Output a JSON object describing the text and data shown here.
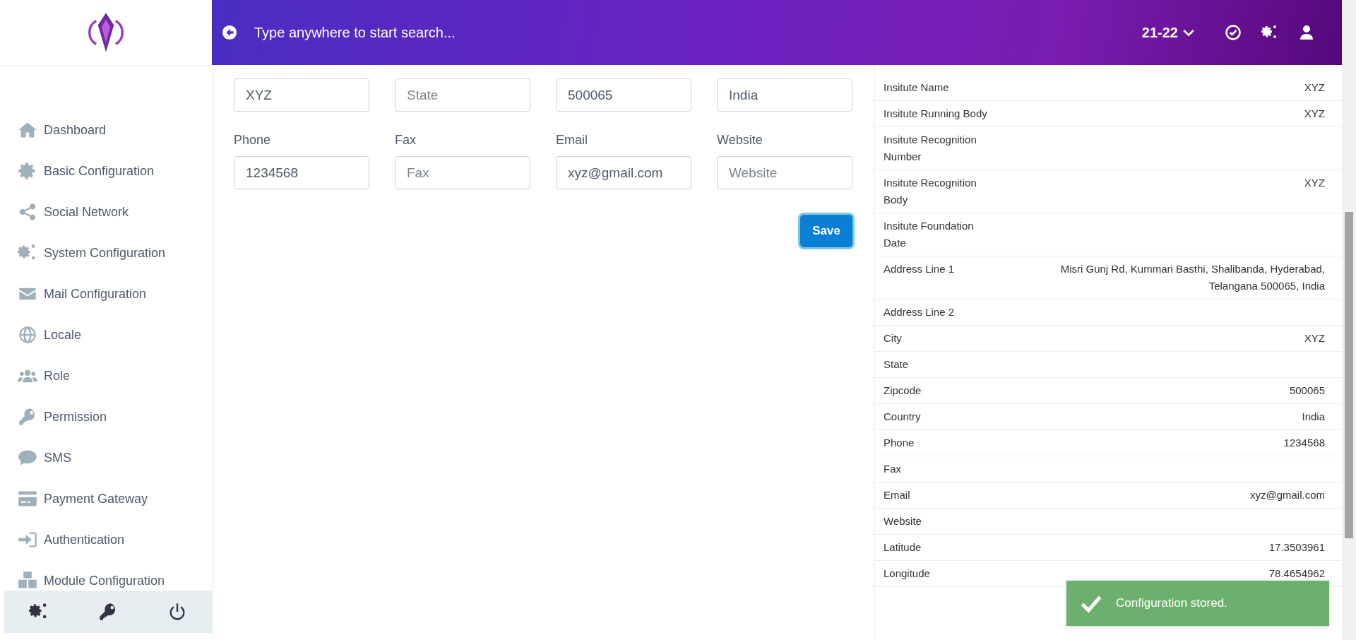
{
  "sidebar": {
    "items": [
      {
        "label": "Dashboard"
      },
      {
        "label": "Basic Configuration"
      },
      {
        "label": "Social Network"
      },
      {
        "label": "System Configuration"
      },
      {
        "label": "Mail Configuration"
      },
      {
        "label": "Locale"
      },
      {
        "label": "Role"
      },
      {
        "label": "Permission"
      },
      {
        "label": "SMS"
      },
      {
        "label": "Payment Gateway"
      },
      {
        "label": "Authentication"
      },
      {
        "label": "Module Configuration"
      }
    ]
  },
  "topbar": {
    "search": {
      "placeholder": "Type anywhere to start search..."
    },
    "session": "21-22"
  },
  "form": {
    "fields": [
      {
        "value": "XYZ"
      },
      {
        "placeholder": "State"
      },
      {
        "value": "500065"
      },
      {
        "value": "India"
      },
      {
        "label": "Phone",
        "value": "1234568"
      },
      {
        "label": "Fax",
        "placeholder": "Fax"
      },
      {
        "label": "Email",
        "value": "xyz@gmail.com"
      },
      {
        "label": "Website",
        "placeholder": "Website"
      }
    ],
    "save_button": "Save"
  },
  "details": {
    "rows": [
      {
        "label": "Insitute Name",
        "value": "XYZ"
      },
      {
        "label": "Insitute Running Body",
        "value": "XYZ"
      },
      {
        "label": "Insitute Recognition Number"
      },
      {
        "label": "Insitute Recognition Body",
        "value": "XYZ"
      },
      {
        "label": "Insitute Foundation Date"
      },
      {
        "label": "Address Line 1",
        "value": "Misri Gunj Rd, Kummari Basthi, Shalibanda, Hyderabad, Telangana 500065, India"
      },
      {
        "label": "Address Line 2"
      },
      {
        "label": "City",
        "value": "XYZ"
      },
      {
        "label": "State"
      },
      {
        "label": "Zipcode",
        "value": "500065"
      },
      {
        "label": "Country",
        "value": "India"
      },
      {
        "label": "Phone",
        "value": "1234568"
      },
      {
        "label": "Fax"
      },
      {
        "label": "Email",
        "value": "xyz@gmail.com"
      },
      {
        "label": "Website"
      },
      {
        "label": "Latitude",
        "value": "17.3503961"
      },
      {
        "label": "Longitude",
        "value": "78.4654962"
      }
    ]
  },
  "toast": {
    "message": "Configuration stored."
  }
}
